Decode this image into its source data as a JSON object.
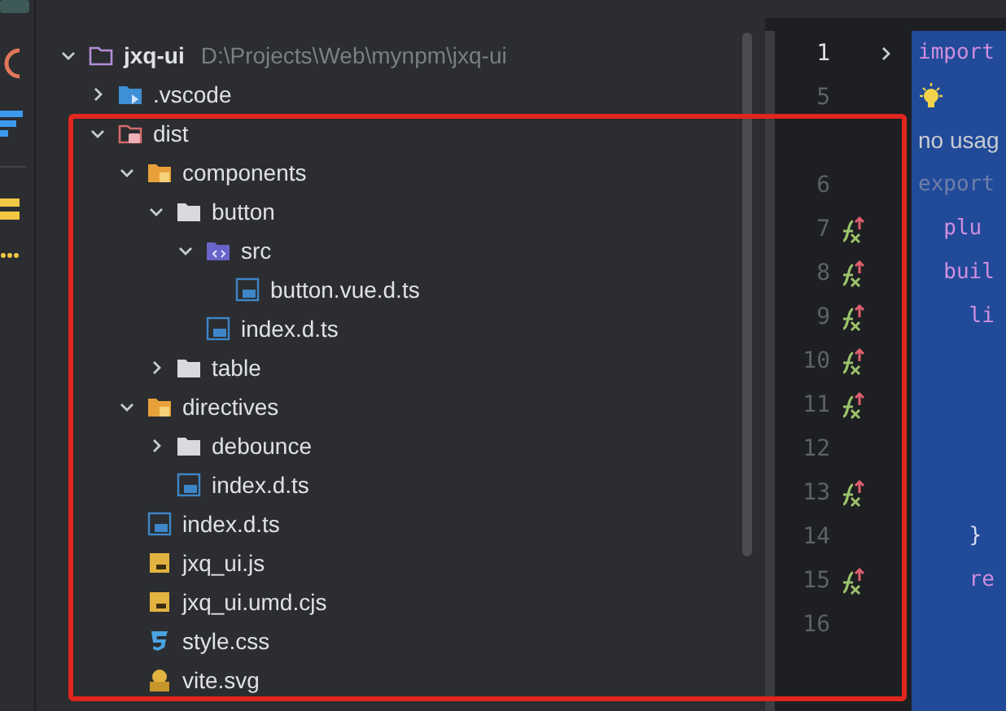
{
  "project_panel": {
    "tree": [
      {
        "name": "jxq-ui",
        "path": "D:\\Projects\\Web\\mynpm\\jxq-ui",
        "kind": "module",
        "expanded": true,
        "children": [
          {
            "name": ".vscode",
            "kind": "folder-vscode",
            "expanded": false
          },
          {
            "name": "dist",
            "kind": "folder-excluded",
            "expanded": true,
            "children": [
              {
                "name": "components",
                "kind": "folder-package",
                "expanded": true,
                "children": [
                  {
                    "name": "button",
                    "kind": "folder",
                    "expanded": true,
                    "children": [
                      {
                        "name": "src",
                        "kind": "folder-source",
                        "expanded": true,
                        "children": [
                          {
                            "name": "button.vue.d.ts",
                            "kind": "ts"
                          }
                        ]
                      },
                      {
                        "name": "index.d.ts",
                        "kind": "ts"
                      }
                    ]
                  },
                  {
                    "name": "table",
                    "kind": "folder",
                    "expanded": false
                  }
                ]
              },
              {
                "name": "directives",
                "kind": "folder-package",
                "expanded": true,
                "children": [
                  {
                    "name": "debounce",
                    "kind": "folder",
                    "expanded": false
                  },
                  {
                    "name": "index.d.ts",
                    "kind": "ts"
                  }
                ]
              },
              {
                "name": "index.d.ts",
                "kind": "ts"
              },
              {
                "name": "jxq_ui.js",
                "kind": "js"
              },
              {
                "name": "jxq_ui.umd.cjs",
                "kind": "js"
              },
              {
                "name": "style.css",
                "kind": "css"
              },
              {
                "name": "vite.svg",
                "kind": "svg"
              }
            ]
          }
        ]
      }
    ]
  },
  "editor": {
    "lines": [
      {
        "number": "1",
        "folded": true,
        "marker": false,
        "kind": "keyword",
        "code": "import"
      },
      {
        "number": "5",
        "folded": false,
        "marker": false,
        "kind": "bulb"
      },
      {
        "folded": false,
        "marker": false,
        "kind": "hint",
        "code": "no usag"
      },
      {
        "number": "6",
        "folded": false,
        "marker": false,
        "kind": "muted",
        "code": "export"
      },
      {
        "number": "7",
        "folded": false,
        "marker": true,
        "kind": "keyword",
        "code": "  plu"
      },
      {
        "number": "8",
        "folded": false,
        "marker": true,
        "kind": "keyword",
        "code": "  buil"
      },
      {
        "number": "9",
        "folded": false,
        "marker": true,
        "kind": "keyword",
        "code": "    li"
      },
      {
        "number": "10",
        "folded": false,
        "marker": true,
        "kind": "keyword"
      },
      {
        "number": "11",
        "folded": false,
        "marker": true,
        "kind": "keyword"
      },
      {
        "number": "12",
        "folded": false,
        "marker": false,
        "kind": "keyword"
      },
      {
        "number": "13",
        "folded": false,
        "marker": true,
        "kind": "keyword"
      },
      {
        "number": "14",
        "folded": false,
        "marker": false,
        "kind": "plain",
        "code": "    }"
      },
      {
        "number": "15",
        "folded": false,
        "marker": true,
        "kind": "keyword",
        "code": "    re"
      },
      {
        "number": "16",
        "folded": false,
        "marker": false,
        "kind": "keyword"
      }
    ]
  }
}
